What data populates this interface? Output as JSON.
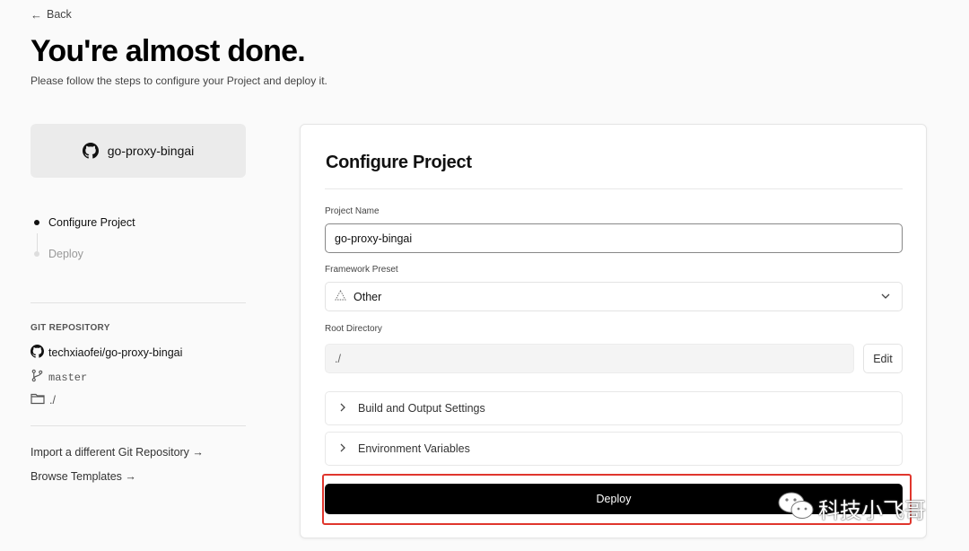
{
  "header": {
    "back_label": "Back",
    "title": "You're almost done.",
    "subtitle": "Please follow the steps to configure your Project and deploy it."
  },
  "repo_card": {
    "name": "go-proxy-bingai",
    "icon": "github-icon"
  },
  "steps": [
    {
      "label": "Configure Project",
      "active": true
    },
    {
      "label": "Deploy",
      "active": false
    }
  ],
  "git": {
    "section_title": "GIT REPOSITORY",
    "repository": "techxiaofei/go-proxy-bingai",
    "branch": "master",
    "directory": "./"
  },
  "links": {
    "import": "Import a different Git Repository →",
    "templates": "Browse Templates →"
  },
  "panel": {
    "title": "Configure Project",
    "project_name_label": "Project Name",
    "project_name_value": "go-proxy-bingai",
    "framework_label": "Framework Preset",
    "framework_value": "Other",
    "root_label": "Root Directory",
    "root_value": "./",
    "edit_label": "Edit",
    "build_settings_label": "Build and Output Settings",
    "env_vars_label": "Environment Variables",
    "deploy_label": "Deploy"
  },
  "watermark": {
    "text": "科技小飞哥"
  },
  "colors": {
    "highlight_outline": "#e0362d",
    "deploy_button": "#000000"
  }
}
